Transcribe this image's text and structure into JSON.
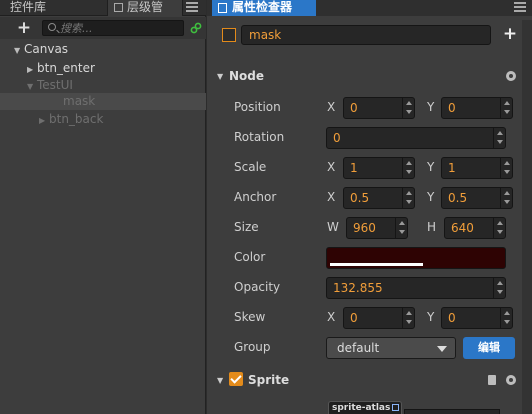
{
  "left_panel": {
    "tabs": {
      "assets": "控件库",
      "hierarchy": "层级管"
    },
    "search_placeholder": "搜索...",
    "tree": [
      {
        "label": "Canvas",
        "state": "expanded"
      },
      {
        "label": "btn_enter",
        "state": "collapsed"
      },
      {
        "label": "TestUI",
        "state": "expanded",
        "dimmed": true
      },
      {
        "label": "mask",
        "selected": true,
        "dimmed": true
      },
      {
        "label": "btn_back",
        "state": "collapsed",
        "dimmed": true
      }
    ]
  },
  "inspector": {
    "tab_title": "属性检查器",
    "node_name": "mask",
    "node_section": {
      "title": "Node",
      "position": {
        "label": "Position",
        "x_label": "X",
        "x": "0",
        "y_label": "Y",
        "y": "0"
      },
      "rotation": {
        "label": "Rotation",
        "value": "0"
      },
      "scale": {
        "label": "Scale",
        "x_label": "X",
        "x": "1",
        "y_label": "Y",
        "y": "1"
      },
      "anchor": {
        "label": "Anchor",
        "x_label": "X",
        "x": "0.5",
        "y_label": "Y",
        "y": "0.5"
      },
      "size": {
        "label": "Size",
        "w_label": "W",
        "w": "960",
        "h_label": "H",
        "h": "640"
      },
      "color": {
        "label": "Color",
        "value": "#2e0303",
        "alpha_fraction": 0.52
      },
      "opacity": {
        "label": "Opacity",
        "value": "132.855"
      },
      "skew": {
        "label": "Skew",
        "x_label": "X",
        "x": "0",
        "y_label": "Y",
        "y": "0"
      },
      "group": {
        "label": "Group",
        "value": "default",
        "edit_button": "编辑"
      }
    },
    "sprite_section": {
      "title": "Sprite",
      "enabled": true,
      "atlas_tag": "sprite-atlas"
    }
  },
  "colors": {
    "accent_blue": "#2b77c8",
    "value_orange": "#f19e3a",
    "checkbox_orange": "#e38b1b"
  }
}
